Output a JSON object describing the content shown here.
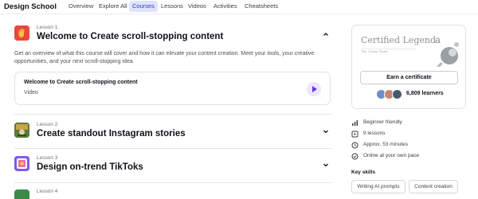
{
  "nav": {
    "brand": "Design School",
    "items": [
      {
        "label": "Overview",
        "active": false
      },
      {
        "label": "Explore All",
        "active": false
      },
      {
        "label": "Courses",
        "active": true
      },
      {
        "label": "Lessons",
        "active": false
      },
      {
        "label": "Videos",
        "active": false
      },
      {
        "label": "Activities",
        "active": false
      },
      {
        "label": "Cheatsheets",
        "active": false
      }
    ]
  },
  "lessons": [
    {
      "number": "Lesson 1",
      "title": "Welcome to Create scroll-stopping content",
      "expanded": true
    },
    {
      "number": "Lesson 2",
      "title": "Create standout Instagram stories",
      "expanded": false
    },
    {
      "number": "Lesson 3",
      "title": "Design on-trend TikToks",
      "expanded": false
    },
    {
      "number": "Lesson 4",
      "title": "",
      "expanded": false
    }
  ],
  "lesson1_detail": {
    "description": "Get an overview of what this course will cover and how it can elevate your content creation. Meet your tools, your creative opportunities, and your next scroll-stopping idea.",
    "video_card": {
      "title": "Welcome to Create scroll-stopping content",
      "type": "Video"
    }
  },
  "certificate": {
    "title": "Certified Legend",
    "signature": "The Canva Team",
    "earn_button": "Earn a certificate",
    "learners": "6,809 learners"
  },
  "course_meta": [
    {
      "icon": "level-bars-icon",
      "text": "Beginner friendly"
    },
    {
      "icon": "lessons-icon",
      "text": "9 lessons"
    },
    {
      "icon": "clock-icon",
      "text": "Approx. 53 minutes"
    },
    {
      "icon": "check-circle-icon",
      "text": "Online at your own pace"
    }
  ],
  "key_skills": {
    "heading": "Key skills",
    "skills": [
      "Writing AI prompts",
      "Content creation"
    ]
  },
  "colors": {
    "accent": "#2f3bbd",
    "active_tab_bg": "#dfe3ff",
    "play_button": "#6a2ee8"
  }
}
